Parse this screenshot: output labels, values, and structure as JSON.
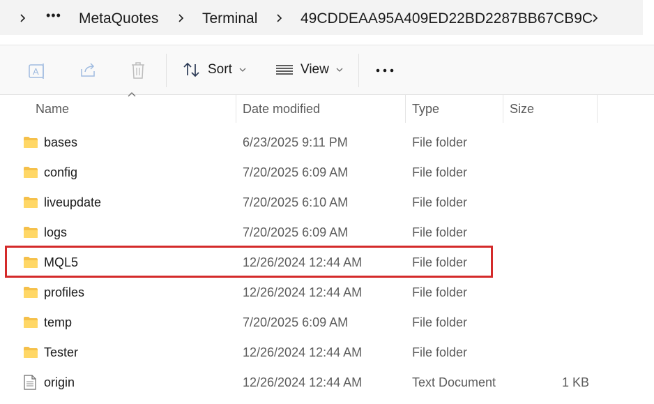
{
  "breadcrumb": {
    "items": [
      "MetaQuotes",
      "Terminal",
      "49CDDEAA95A409ED22BD2287BB67CB9C"
    ]
  },
  "toolbar": {
    "sort_label": "Sort",
    "view_label": "View"
  },
  "columns": {
    "name": "Name",
    "date": "Date modified",
    "type": "Type",
    "size": "Size"
  },
  "rows": [
    {
      "name": "bases",
      "date": "6/23/2025 9:11 PM",
      "type": "File folder",
      "size": "",
      "icon": "folder-icon"
    },
    {
      "name": "config",
      "date": "7/20/2025 6:09 AM",
      "type": "File folder",
      "size": "",
      "icon": "folder-icon"
    },
    {
      "name": "liveupdate",
      "date": "7/20/2025 6:10 AM",
      "type": "File folder",
      "size": "",
      "icon": "folder-icon"
    },
    {
      "name": "logs",
      "date": "7/20/2025 6:09 AM",
      "type": "File folder",
      "size": "",
      "icon": "folder-icon"
    },
    {
      "name": "MQL5",
      "date": "12/26/2024 12:44 AM",
      "type": "File folder",
      "size": "",
      "icon": "folder-icon"
    },
    {
      "name": "profiles",
      "date": "12/26/2024 12:44 AM",
      "type": "File folder",
      "size": "",
      "icon": "folder-icon"
    },
    {
      "name": "temp",
      "date": "7/20/2025 6:09 AM",
      "type": "File folder",
      "size": "",
      "icon": "folder-icon"
    },
    {
      "name": "Tester",
      "date": "12/26/2024 12:44 AM",
      "type": "File folder",
      "size": "",
      "icon": "folder-icon"
    },
    {
      "name": "origin",
      "date": "12/26/2024 12:44 AM",
      "type": "Text Document",
      "size": "1 KB",
      "icon": "text-document-icon"
    }
  ],
  "colors": {
    "highlight": "#d42a2a",
    "folder": "#f5c04a"
  }
}
